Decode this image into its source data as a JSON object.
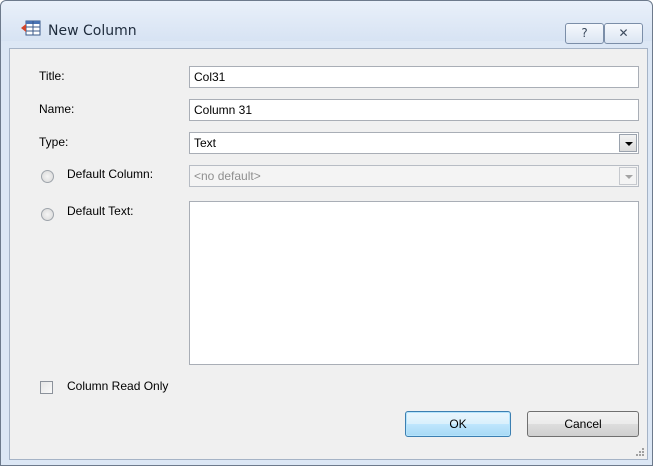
{
  "window": {
    "title": "New Column",
    "help_glyph": "?",
    "close_glyph": "✕"
  },
  "form": {
    "title_label": "Title:",
    "title_value": "Col31",
    "name_label": "Name:",
    "name_value": "Column 31",
    "type_label": "Type:",
    "type_value": "Text",
    "default_column_label": "Default Column:",
    "default_column_value": "<no default>",
    "default_text_label": "Default Text:",
    "default_text_value": "",
    "read_only_label": "Column Read Only"
  },
  "buttons": {
    "ok": "OK",
    "cancel": "Cancel"
  },
  "icons": {
    "app": "table-column-icon",
    "dropdown": "chevron-down-icon",
    "resize": "resize-grip-icon"
  }
}
